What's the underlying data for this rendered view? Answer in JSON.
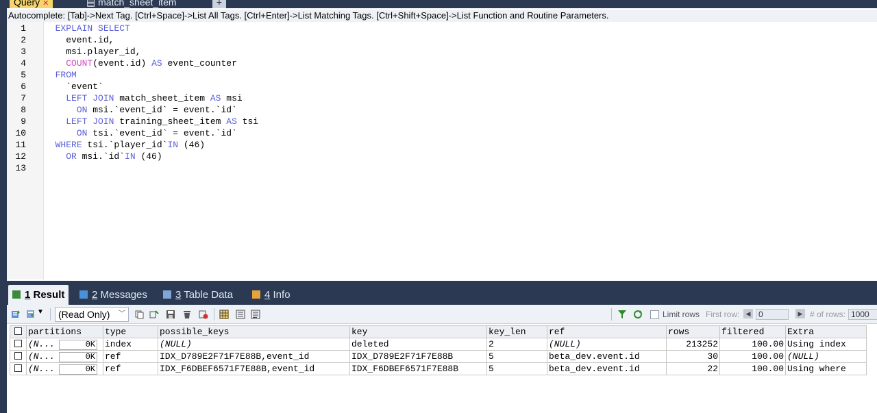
{
  "tabs": {
    "query_label": "Query",
    "second_label": "match_sheet_item",
    "plus_label": "+"
  },
  "autocomplete": "Autocomplete: [Tab]->Next Tag. [Ctrl+Space]->List All Tags. [Ctrl+Enter]->List Matching Tags. [Ctrl+Shift+Space]->List Function and Routine Parameters.",
  "editor": {
    "line_numbers": [
      "1",
      "2",
      "3",
      "4",
      "5",
      "6",
      "7",
      "8",
      "9",
      "10",
      "11",
      "12",
      "13"
    ],
    "lines": [
      [
        {
          "t": "  EXPLAIN SELECT",
          "c": "kw"
        }
      ],
      [
        {
          "t": "    event.id,",
          "c": ""
        }
      ],
      [
        {
          "t": "    msi.player_id,",
          "c": ""
        }
      ],
      [
        {
          "t": "    ",
          "c": ""
        },
        {
          "t": "COUNT",
          "c": "fn"
        },
        {
          "t": "(event.id) ",
          "c": ""
        },
        {
          "t": "AS",
          "c": "kw"
        },
        {
          "t": " event_counter",
          "c": ""
        }
      ],
      [
        {
          "t": "  FROM",
          "c": "kw"
        }
      ],
      [
        {
          "t": "    `event`",
          "c": ""
        }
      ],
      [
        {
          "t": "    ",
          "c": ""
        },
        {
          "t": "LEFT JOIN",
          "c": "kw"
        },
        {
          "t": " match_sheet_item ",
          "c": ""
        },
        {
          "t": "AS",
          "c": "kw"
        },
        {
          "t": " msi",
          "c": ""
        }
      ],
      [
        {
          "t": "      ",
          "c": ""
        },
        {
          "t": "ON",
          "c": "kw"
        },
        {
          "t": " msi.`event_id` = event.`id`",
          "c": ""
        }
      ],
      [
        {
          "t": "    ",
          "c": ""
        },
        {
          "t": "LEFT JOIN",
          "c": "kw"
        },
        {
          "t": " training_sheet_item ",
          "c": ""
        },
        {
          "t": "AS",
          "c": "kw"
        },
        {
          "t": " tsi",
          "c": ""
        }
      ],
      [
        {
          "t": "      ",
          "c": ""
        },
        {
          "t": "ON",
          "c": "kw"
        },
        {
          "t": " tsi.`event_id` = event.`id`",
          "c": ""
        }
      ],
      [
        {
          "t": "  ",
          "c": ""
        },
        {
          "t": "WHERE",
          "c": "kw"
        },
        {
          "t": " tsi.`player_id`",
          "c": ""
        },
        {
          "t": "IN",
          "c": "kw"
        },
        {
          "t": " (46)",
          "c": ""
        }
      ],
      [
        {
          "t": "    ",
          "c": ""
        },
        {
          "t": "OR",
          "c": "kw"
        },
        {
          "t": " msi.`id`",
          "c": ""
        },
        {
          "t": "IN",
          "c": "kw"
        },
        {
          "t": " (46)",
          "c": ""
        }
      ],
      [
        {
          "t": "",
          "c": ""
        }
      ]
    ]
  },
  "result_tabs": [
    {
      "num": "1",
      "label": "Result",
      "icon_color": "#3a8a3a"
    },
    {
      "num": "2",
      "label": "Messages",
      "icon_color": "#4a90d9"
    },
    {
      "num": "3",
      "label": "Table Data",
      "icon_color": "#7fa6d6"
    },
    {
      "num": "4",
      "label": "Info",
      "icon_color": "#e6a23c"
    }
  ],
  "toolbar": {
    "mode": "(Read Only)",
    "limit_rows": "Limit rows",
    "first_row": "First row:",
    "first_row_value": "0",
    "rows_label": "# of rows:",
    "rows_value": "1000"
  },
  "grid": {
    "columns": [
      "partitions",
      "type",
      "possible_keys",
      "key",
      "key_len",
      "ref",
      "rows",
      "filtered",
      "Extra"
    ],
    "rows": [
      {
        "partitions": "(N...",
        "ok": "0K",
        "type": "index",
        "possible_keys": "(NULL)",
        "key": "deleted",
        "key_len": "2",
        "ref": "(NULL)",
        "rows": "213252",
        "filtered": "100.00",
        "extra": "Using index"
      },
      {
        "partitions": "(N...",
        "ok": "0K",
        "type": "ref",
        "possible_keys": "IDX_D789E2F71F7E88B,event_id",
        "key": "IDX_D789E2F71F7E88B",
        "key_len": "5",
        "ref": "beta_dev.event.id",
        "rows": "30",
        "filtered": "100.00",
        "extra": "(NULL)"
      },
      {
        "partitions": "(N...",
        "ok": "0K",
        "type": "ref",
        "possible_keys": "IDX_F6DBEF6571F7E88B,event_id",
        "key": "IDX_F6DBEF6571F7E88B",
        "key_len": "5",
        "ref": "beta_dev.event.id",
        "rows": "22",
        "filtered": "100.00",
        "extra": "Using where"
      }
    ]
  }
}
